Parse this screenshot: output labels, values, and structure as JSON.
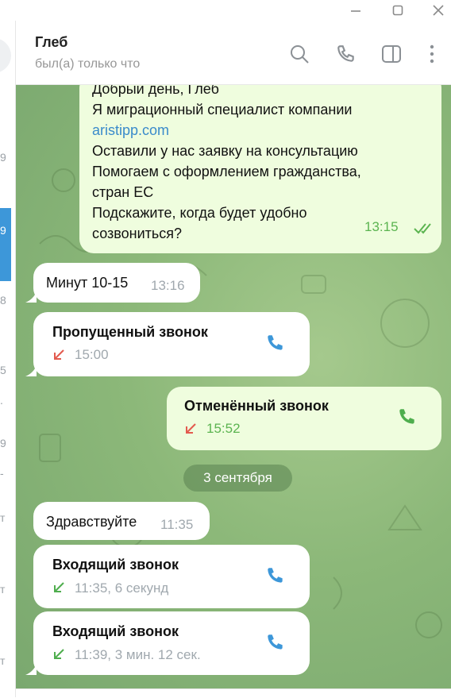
{
  "window": {
    "controls": [
      "minimize-icon",
      "maximize-icon",
      "close-icon"
    ]
  },
  "sidebar": {
    "marks": [
      "9",
      "9",
      "8",
      "5",
      ".",
      "9",
      "-",
      "т",
      "т",
      "т"
    ]
  },
  "header": {
    "name": "Глеб",
    "status": "был(а) только что",
    "icons": [
      "search-icon",
      "phone-icon",
      "sidebar-toggle-icon",
      "more-icon"
    ]
  },
  "messages": {
    "first": {
      "lines": [
        "Добрый день, Глеб",
        "Я  миграционный специалист компании"
      ],
      "link": "aristipp.com",
      "lines2": [
        "Оставили у нас заявку на консультацию",
        "Помогаем с оформлением гражданства,",
        "стран ЕС",
        "Подскажите, когда будет удобно",
        "созвониться?"
      ],
      "time": "13:15"
    },
    "m2": {
      "text": "Минут 10-15",
      "time": "13:16"
    },
    "call1": {
      "title": "Пропущенный звонок",
      "sub": "15:00"
    },
    "call2": {
      "title": "Отменённый звонок",
      "sub": "15:52"
    },
    "date": "3 сентября",
    "m3": {
      "text": "Здравствуйте",
      "time": "11:35"
    },
    "call3": {
      "title": "Входящий звонок",
      "sub": "11:35, 6 секунд"
    },
    "call4": {
      "title": "Входящий звонок",
      "sub": "11:39, 3 мин. 12 сек."
    }
  },
  "colors": {
    "accent": "#3d97d9",
    "out_bubble": "#effdde",
    "out_time": "#5bb450",
    "missed": "#e35a4e",
    "incoming": "#4fae4e"
  }
}
